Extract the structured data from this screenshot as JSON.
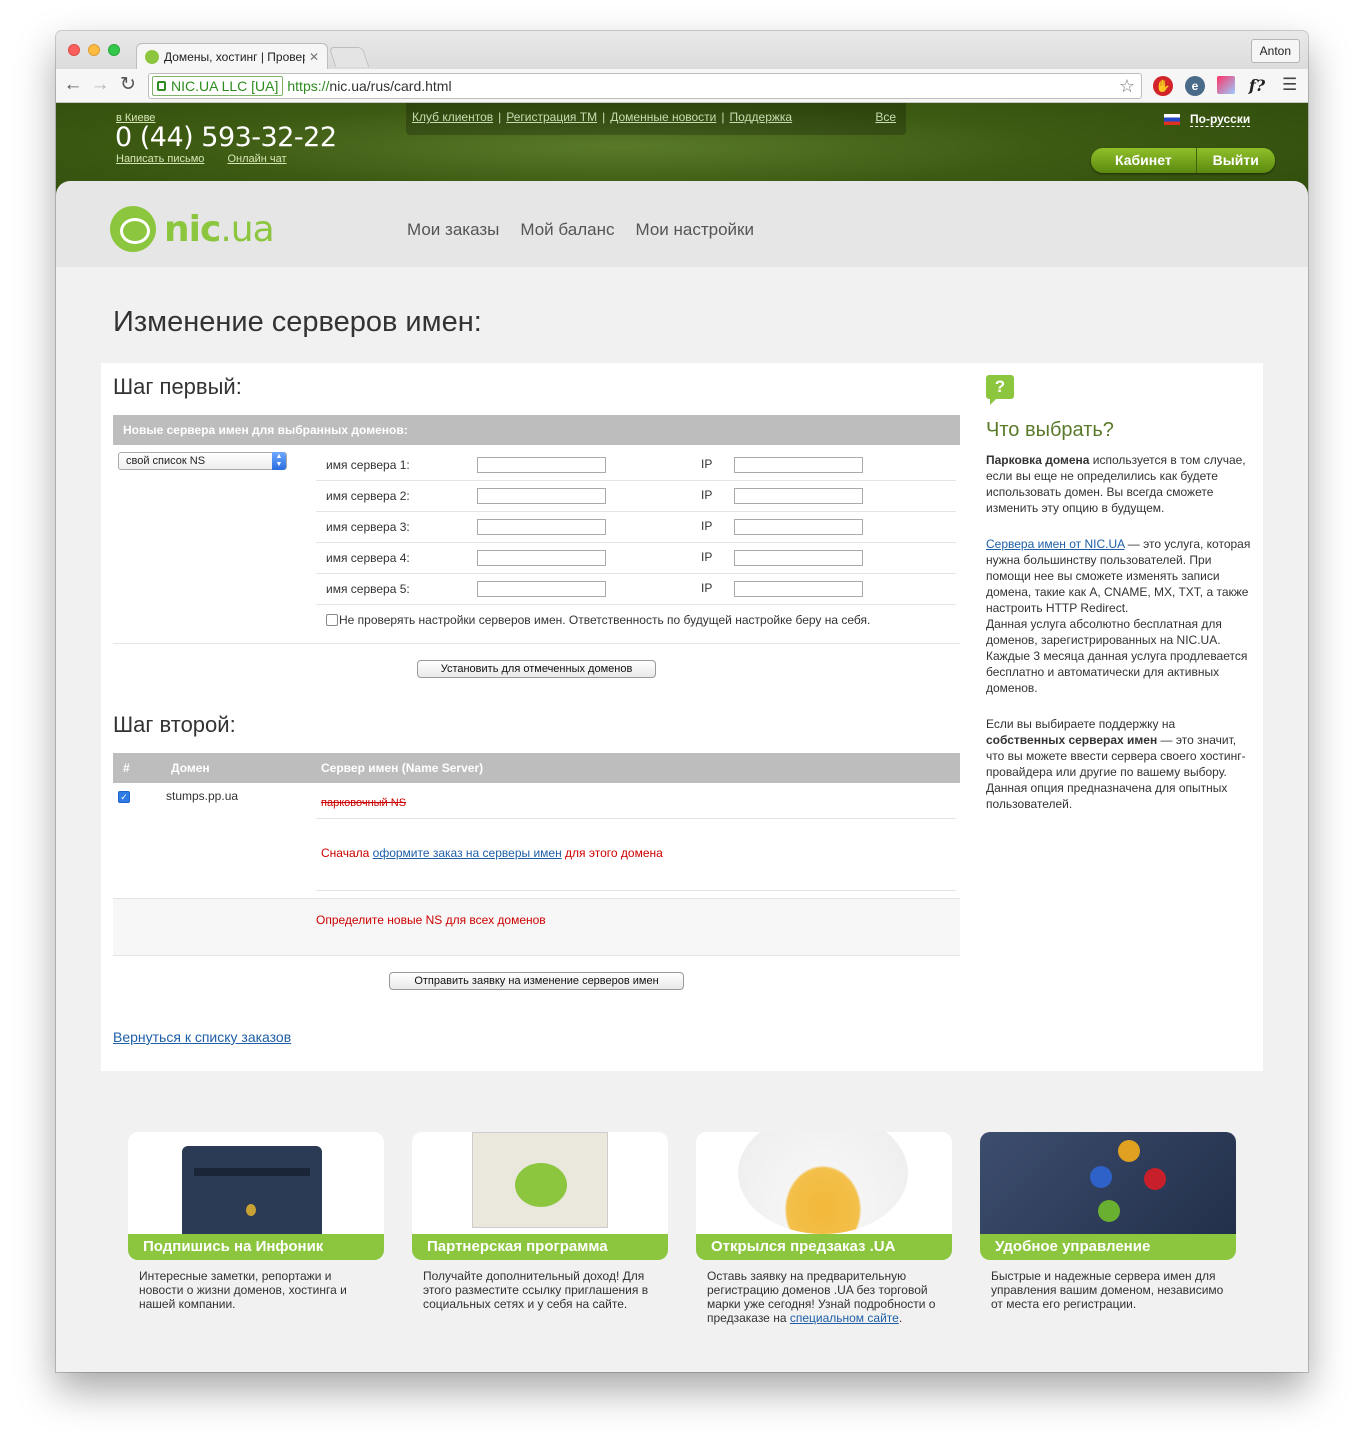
{
  "browser": {
    "tab_title": "Домены, хостинг | Провер",
    "profile": "Anton",
    "ev_label": "NIC.UA LLC [UA]",
    "url_proto": "https://",
    "url_rest": "nic.ua/rus/card.html"
  },
  "header": {
    "city": "в Киеве",
    "phone": "0 (44) 593-32-22",
    "write_letter": "Написать письмо",
    "online_chat": "Онлайн чат",
    "topnav": [
      "Клуб клиентов",
      "Регистрация ТМ",
      "Доменные новости",
      "Поддержка"
    ],
    "topnav_all": "Все",
    "language": "По-русски",
    "cabinet": "Кабинет",
    "logout": "Выйти"
  },
  "logo": {
    "name": "nic",
    "tld": ".ua"
  },
  "mainnav": [
    "Мои заказы",
    "Мой баланс",
    "Мои настройки"
  ],
  "page_title": "Изменение серверов имен:",
  "step1": {
    "title": "Шаг первый:",
    "bar": "Новые сервера имен для выбранных доменов:",
    "select_value": "свой список NS",
    "server_label": [
      "имя сервера 1:",
      "имя сервера 2:",
      "имя сервера 3:",
      "имя сервера 4:",
      "имя сервера 5:"
    ],
    "ip_label": "IP",
    "nocheck": "Не проверять настройки серверов имен. Ответственность по будущей настройке беру на себя.",
    "apply_button": "Установить для отмеченных доменов"
  },
  "step2": {
    "title": "Шаг второй:",
    "col_num": "#",
    "col_domain": "Домен",
    "col_ns": "Сервер имен (Name Server)",
    "domain": "stumps.pp.ua",
    "parked": "парковочный NS",
    "order_before": "Сначала ",
    "order_link": "оформите заказ на серверы имен",
    "order_after": " для этого домена",
    "define_ns": "Определите новые NS для всех доменов",
    "submit_button": "Отправить заявку на изменение серверов имен"
  },
  "back_link": "Вернуться к списку заказов",
  "sidebar": {
    "title": "Что выбрать?",
    "p1_bold": "Парковка домена",
    "p1": " используется в том случае, если вы еще не определились как будете использовать домен. Вы всегда сможете изменить эту опцию в будущем.",
    "p2_link": "Сервера имен от NIC.UA",
    "p2": " — это услуга, которая нужна большинству пользователей. При помощи нее вы сможете изменять записи домена, такие как A, CNAME, MX, TXT, а также настроить HTTP Redirect.",
    "p2b": "Данная услуга абсолютно бесплатная для доменов, зарегистрированных на NIC.UA. Каждые 3 месяца данная услуга продлевается бесплатно и автоматически для активных доменов.",
    "p3a": "Если вы выбираете поддержку на ",
    "p3_bold": "собственных серверах имен",
    "p3": " — это значит, что вы можете ввести сервера своего хостинг-провайдера или другие по вашему выбору. Данная опция предназначена для опытных пользователей."
  },
  "promos": [
    {
      "title": "Подпишись на Инфоник",
      "text": "Интересные заметки, репортажи и новости о жизни доменов, хостинга и нашей компании."
    },
    {
      "title": "Партнерская программа",
      "text": "Получайте дополнительный доход! Для этого разместите ссылку приглашения в социальных сетях и у себя на сайте."
    },
    {
      "title": "Открылся предзаказ .UA",
      "text": "Оставь заявку на предварительную регистрацию доменов .UA без торговой марки уже сегодня! Узнай подробности о предзаказе на ",
      "link": "специальном сайте",
      "tail": "."
    },
    {
      "title": "Удобное управление",
      "text": "Быстрые и надежные сервера имен для управления вашим доменом, независимо от места его регистрации."
    }
  ],
  "colors": {
    "brand_green": "#8cc63f",
    "header_dark": "#3d5a12",
    "error_red": "#cc0000",
    "link_blue": "#1e5fa8"
  }
}
